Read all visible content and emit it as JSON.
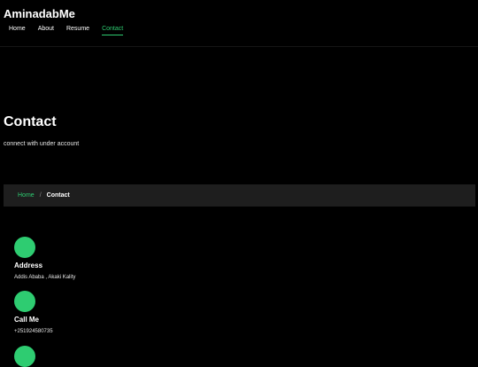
{
  "header": {
    "logo": "AminadabMe",
    "nav": [
      {
        "label": "Home",
        "active": false
      },
      {
        "label": "About",
        "active": false
      },
      {
        "label": "Resume",
        "active": false
      },
      {
        "label": "Contact",
        "active": true
      }
    ]
  },
  "hero": {
    "title": "Contact",
    "subtitle": "connect with under account"
  },
  "breadcrumb": {
    "home": "Home",
    "separator": "/",
    "current": "Contact"
  },
  "contacts": [
    {
      "label": "Address",
      "value": "Addis Ababa , Akaki Kality",
      "icon": "map-marker-icon"
    },
    {
      "label": "Call Me",
      "value": "+251924580735",
      "icon": "phone-icon"
    },
    {
      "label": "",
      "value": "",
      "icon": "envelope-icon"
    }
  ],
  "colors": {
    "accent": "#2ecc71",
    "background": "#000000",
    "breadcrumb_bg": "#1e1e1e"
  }
}
